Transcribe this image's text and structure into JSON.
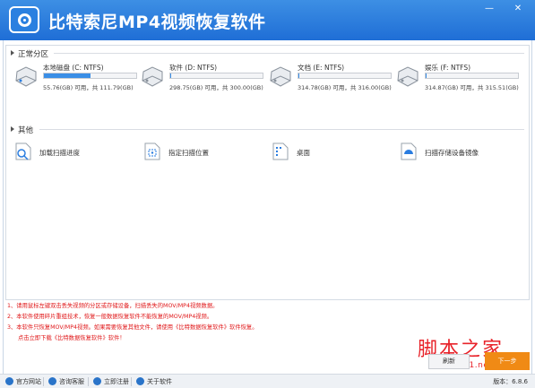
{
  "app": {
    "title": "比特索尼MP4视频恢复软件"
  },
  "window_controls": {
    "minimize": "—",
    "close": "✕"
  },
  "sections": {
    "partitions": "正常分区",
    "other": "其他"
  },
  "drives": [
    {
      "name": "本地磁盘 (C: NTFS)",
      "size_text": "55.76(GB) 可用，共 111.79(GB)",
      "used_fraction": 0.5
    },
    {
      "name": "软件 (D: NTFS)",
      "size_text": "298.75(GB) 可用，共 300.00(GB)",
      "used_fraction": 0.004
    },
    {
      "name": "文档 (E: NTFS)",
      "size_text": "314.78(GB) 可用，共 316.00(GB)",
      "used_fraction": 0.004
    },
    {
      "name": "娱乐 (F: NTFS)",
      "size_text": "314.87(GB) 可用，共 315.51(GB)",
      "used_fraction": 0.002
    }
  ],
  "tools": [
    {
      "label": "加载扫描进度",
      "icon": "load-scan-progress-icon"
    },
    {
      "label": "指定扫描位置",
      "icon": "specify-scan-location-icon"
    },
    {
      "label": "桌面",
      "icon": "desktop-icon"
    },
    {
      "label": "扫描存储设备镜像",
      "icon": "scan-device-image-icon"
    }
  ],
  "notes": [
    "1、请用鼠标左键双击丢失视频的分区或存储设备，扫描丢失的MOV/MP4视频数据。",
    "2、本软件使用碎片重组技术，恢复一般数据恢复软件不能恢复的MOV/MP4视频。",
    "3、本软件只恢复MOV/MP4视频。如果需要恢复其他文件，请使用《比特数据恢复软件》软件恢复。",
    "点击立即下载《比特数据恢复软件》软件！"
  ],
  "buttons": {
    "refresh": "刷新",
    "next": "下一步"
  },
  "watermark": {
    "text": "脚本之家",
    "url": "www.jb51.net"
  },
  "statusbar": {
    "items": [
      "官方网站",
      "咨询客服",
      "立即注册",
      "关于软件"
    ],
    "version": "版本：6.8.6"
  },
  "colors": {
    "titlebar": "#2a7de0",
    "accent": "#3a8ee6",
    "note_red": "#e0181a",
    "next_button": "#f08a15"
  }
}
